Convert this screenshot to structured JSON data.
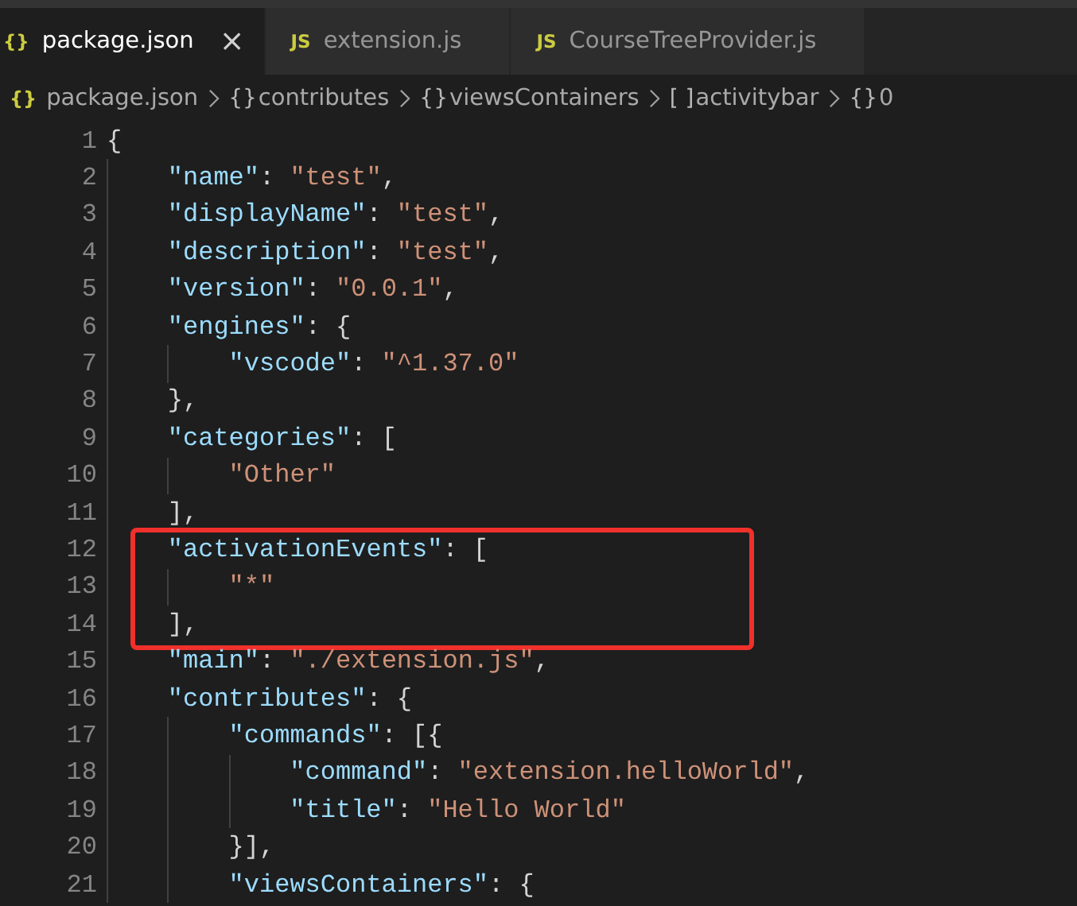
{
  "tabs": [
    {
      "icon": "{}",
      "label": "package.json",
      "selected": true,
      "close": "×"
    },
    {
      "icon": "JS",
      "label": "extension.js",
      "selected": false
    },
    {
      "icon": "JS",
      "label": "CourseTreeProvider.js",
      "selected": false
    }
  ],
  "breadcrumb": [
    {
      "icon": "{}",
      "label": "package.json"
    },
    {
      "icon": "{}",
      "label": "contributes"
    },
    {
      "icon": "{}",
      "label": "viewsContainers"
    },
    {
      "icon": "[ ]",
      "label": "activitybar"
    },
    {
      "icon": "{}",
      "label": "0"
    }
  ],
  "code_lines": [
    {
      "number": "1",
      "highlighted": false,
      "tokens": [
        {
          "kind": "punct",
          "text": "{"
        }
      ],
      "children": [
        {
          "number": "2",
          "highlighted": false,
          "tokens": [
            {
              "kind": "key",
              "text": "\"name\""
            },
            {
              "kind": "punct",
              "text": ": "
            },
            {
              "kind": "string",
              "text": "\"test\""
            },
            {
              "kind": "punct",
              "text": ","
            }
          ]
        },
        {
          "number": "3",
          "highlighted": false,
          "tokens": [
            {
              "kind": "key",
              "text": "\"displayName\""
            },
            {
              "kind": "punct",
              "text": ": "
            },
            {
              "kind": "string",
              "text": "\"test\""
            },
            {
              "kind": "punct",
              "text": ","
            }
          ]
        },
        {
          "number": "4",
          "highlighted": false,
          "tokens": [
            {
              "kind": "key",
              "text": "\"description\""
            },
            {
              "kind": "punct",
              "text": ": "
            },
            {
              "kind": "string",
              "text": "\"test\""
            },
            {
              "kind": "punct",
              "text": ","
            }
          ]
        },
        {
          "number": "5",
          "highlighted": false,
          "tokens": [
            {
              "kind": "key",
              "text": "\"version\""
            },
            {
              "kind": "punct",
              "text": ": "
            },
            {
              "kind": "string",
              "text": "\"0.0.1\""
            },
            {
              "kind": "punct",
              "text": ","
            }
          ]
        },
        {
          "number": "6",
          "highlighted": false,
          "tokens": [
            {
              "kind": "key",
              "text": "\"engines\""
            },
            {
              "kind": "punct",
              "text": ": {"
            }
          ],
          "children": [
            {
              "number": "7",
              "highlighted": false,
              "tokens": [
                {
                  "kind": "key",
                  "text": "\"vscode\""
                },
                {
                  "kind": "punct",
                  "text": ": "
                },
                {
                  "kind": "string",
                  "text": "\"^1.37.0\""
                }
              ]
            }
          ]
        },
        {
          "number": "8",
          "highlighted": false,
          "tokens": [
            {
              "kind": "punct",
              "text": "},"
            }
          ]
        },
        {
          "number": "9",
          "highlighted": false,
          "tokens": [
            {
              "kind": "key",
              "text": "\"categories\""
            },
            {
              "kind": "punct",
              "text": ": ["
            }
          ],
          "children": [
            {
              "number": "10",
              "highlighted": false,
              "tokens": [
                {
                  "kind": "string",
                  "text": "\"Other\""
                }
              ]
            }
          ]
        },
        {
          "number": "11",
          "highlighted": false,
          "tokens": [
            {
              "kind": "punct",
              "text": "],"
            }
          ]
        },
        {
          "number": "12",
          "highlighted": true,
          "tokens": [
            {
              "kind": "key",
              "text": "\"activationEvents\""
            },
            {
              "kind": "punct",
              "text": ": ["
            }
          ],
          "children": [
            {
              "number": "13",
              "highlighted": true,
              "tokens": [
                {
                  "kind": "string",
                  "text": "\"*\""
                }
              ]
            }
          ]
        },
        {
          "number": "14",
          "highlighted": true,
          "tokens": [
            {
              "kind": "punct",
              "text": "],"
            }
          ]
        },
        {
          "number": "15",
          "highlighted": false,
          "tokens": [
            {
              "kind": "key",
              "text": "\"main\""
            },
            {
              "kind": "punct",
              "text": ": "
            },
            {
              "kind": "string",
              "text": "\"./extension.js\""
            },
            {
              "kind": "punct",
              "text": ","
            }
          ]
        },
        {
          "number": "16",
          "highlighted": false,
          "tokens": [
            {
              "kind": "key",
              "text": "\"contributes\""
            },
            {
              "kind": "punct",
              "text": ": {"
            }
          ],
          "children": [
            {
              "number": "17",
              "highlighted": false,
              "tokens": [
                {
                  "kind": "key",
                  "text": "\"commands\""
                },
                {
                  "kind": "punct",
                  "text": ": [{"
                }
              ],
              "children": [
                {
                  "number": "18",
                  "highlighted": false,
                  "tokens": [
                    {
                      "kind": "key",
                      "text": "\"command\""
                    },
                    {
                      "kind": "punct",
                      "text": ": "
                    },
                    {
                      "kind": "string",
                      "text": "\"extension.helloWorld\""
                    },
                    {
                      "kind": "punct",
                      "text": ","
                    }
                  ]
                },
                {
                  "number": "19",
                  "highlighted": false,
                  "tokens": [
                    {
                      "kind": "key",
                      "text": "\"title\""
                    },
                    {
                      "kind": "punct",
                      "text": ": "
                    },
                    {
                      "kind": "string",
                      "text": "\"Hello World\""
                    }
                  ]
                }
              ]
            },
            {
              "number": "20",
              "highlighted": false,
              "tokens": [
                {
                  "kind": "punct",
                  "text": "}],"
                }
              ]
            },
            {
              "number": "21",
              "highlighted": false,
              "tokens": [
                {
                  "kind": "key",
                  "text": "\"viewsContainers\""
                },
                {
                  "kind": "punct",
                  "text": ": {"
                }
              ]
            }
          ]
        }
      ]
    }
  ]
}
